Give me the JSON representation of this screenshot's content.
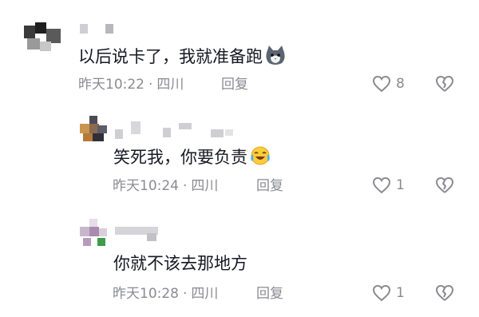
{
  "comments": [
    {
      "text": "以后说卡了，我就准备跑",
      "time": "昨天10:22",
      "location": "四川",
      "reply_label": "回复",
      "likes": "8",
      "emoji": "cat-face-icon"
    },
    {
      "text": "笑死我，你要负责",
      "time": "昨天10:24",
      "location": "四川",
      "reply_label": "回复",
      "likes": "1",
      "emoji": "tears-of-joy-emoji"
    },
    {
      "text": "你就不该去那地方",
      "time": "昨天10:28",
      "location": "四川",
      "reply_label": "回复",
      "likes": "1"
    }
  ],
  "separator": "·",
  "colors": {
    "text": "#161823",
    "meta": "#8a8b91",
    "blur": "#cfcfd3"
  }
}
